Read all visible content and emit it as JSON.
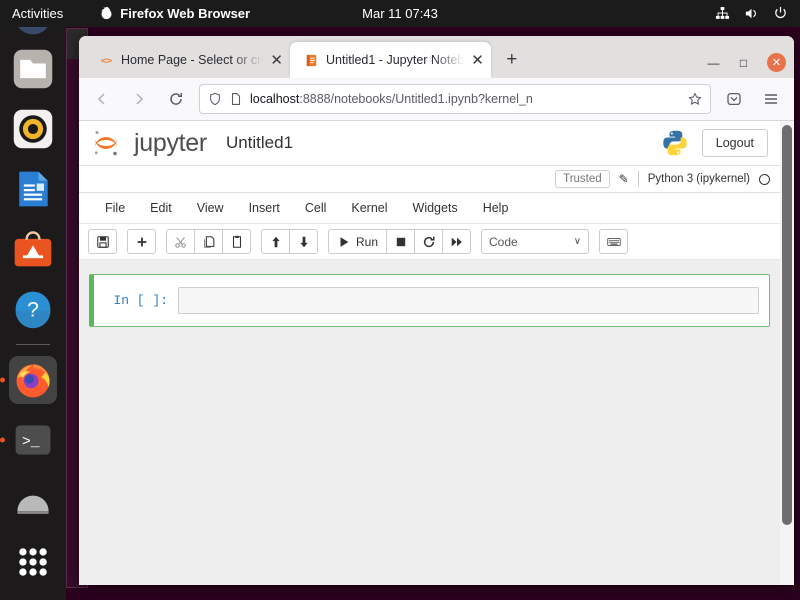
{
  "topbar": {
    "activities": "Activities",
    "app_name": "Firefox Web Browser",
    "clock": "Mar 11  07:43",
    "icons": [
      "network-icon",
      "volume-icon",
      "power-icon"
    ]
  },
  "dock": {
    "items": [
      {
        "name": "firefox-partial",
        "label": "Firefox"
      },
      {
        "name": "files",
        "label": "Files"
      },
      {
        "name": "rhythmbox",
        "label": "Rhythmbox"
      },
      {
        "name": "libreoffice-writer",
        "label": "LibreOffice Writer"
      },
      {
        "name": "ubuntu-software",
        "label": "Ubuntu Software"
      },
      {
        "name": "help",
        "label": "Help"
      },
      {
        "name": "firefox",
        "label": "Firefox Web Browser"
      },
      {
        "name": "terminal",
        "label": "Terminal"
      },
      {
        "name": "trash",
        "label": "Trash"
      },
      {
        "name": "show-applications",
        "label": "Show Applications"
      }
    ]
  },
  "browser": {
    "tabs": [
      {
        "title": "Home Page - Select or cre",
        "favicon": "jupyter-icon",
        "active": false,
        "close": "✕"
      },
      {
        "title": "Untitled1 - Jupyter Noteb",
        "favicon": "notebook-icon",
        "active": true,
        "close": "✕"
      }
    ],
    "new_tab_label": "+",
    "window_controls": {
      "minimize": "—",
      "maximize": "□",
      "close": "✕"
    },
    "url_prefix": "localhost",
    "url_rest": ":8888/notebooks/Untitled1.ipynb?kernel_n",
    "url_full": "localhost:8888/notebooks/Untitled1.ipynb?kernel_n"
  },
  "jupyter": {
    "brand": "jupyter",
    "notebook_title": "Untitled1",
    "logout_label": "Logout",
    "trusted_label": "Trusted",
    "kernel_name": "Python 3 (ipykernel)",
    "menu": [
      "File",
      "Edit",
      "View",
      "Insert",
      "Cell",
      "Kernel",
      "Widgets",
      "Help"
    ],
    "toolbar": {
      "save": "save-icon",
      "insert": "plus-icon",
      "cut": "scissors-icon",
      "copy": "copy-icon",
      "paste": "paste-icon",
      "move_up": "arrow-up-icon",
      "move_down": "arrow-down-icon",
      "run_label": "Run",
      "stop": "stop-icon",
      "restart": "restart-icon",
      "restart_run_all": "fast-forward-icon",
      "cell_type": "Code",
      "cell_type_chevron": "∨",
      "command_palette": "keyboard-icon"
    },
    "cells": [
      {
        "prompt": "In [ ]:",
        "source": "",
        "selected": true
      }
    ]
  },
  "colors": {
    "jupyter_orange": "#f37726",
    "cell_selected_green": "#5cb85c",
    "prompt_blue": "#307fc1",
    "ubuntu_orange": "#e95420",
    "topbar_bg": "#1b1b1b",
    "dock_bg": "#1c1a1b",
    "desktop_bg": "#2c001e",
    "canvas_bg": "#eeeeee"
  }
}
